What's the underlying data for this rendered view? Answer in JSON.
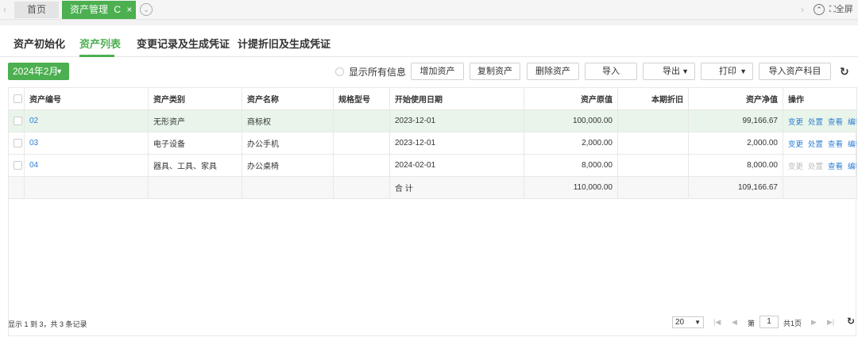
{
  "topbar": {
    "home_tab": "首页",
    "active_tab": "资产管理",
    "refresh_glyph": "C",
    "close_glyph": "×",
    "fullscreen_label": "全屏"
  },
  "subtabs": [
    "资产初始化",
    "资产列表",
    "变更记录及生成凭证",
    "计提折旧及生成凭证"
  ],
  "toolbar": {
    "period": "2024年2月",
    "show_all_label": "显示所有信息",
    "buttons": [
      "增加资产",
      "复制资产",
      "删除资产",
      "导入",
      "导出",
      "打印",
      "导入资产科目"
    ]
  },
  "table": {
    "headers": [
      "资产编号",
      "资产类别",
      "资产名称",
      "规格型号",
      "开始使用日期",
      "资产原值",
      "本期折旧",
      "资产净值",
      "操作"
    ],
    "rows": [
      {
        "code": "02",
        "category": "无形资产",
        "name": "商标权",
        "spec": "",
        "start_date": "2023-12-01",
        "original": "100,000.00",
        "depreciation": "",
        "net": "99,166.67",
        "actions": [
          "变更",
          "处置",
          "查看",
          "编辑"
        ]
      },
      {
        "code": "03",
        "category": "电子设备",
        "name": "办公手机",
        "spec": "",
        "start_date": "2023-12-01",
        "original": "2,000.00",
        "depreciation": "",
        "net": "2,000.00",
        "actions": [
          "变更",
          "处置",
          "查看",
          "编辑"
        ]
      },
      {
        "code": "04",
        "category": "器具、工具、家具",
        "name": "办公桌椅",
        "spec": "",
        "start_date": "2024-02-01",
        "original": "8,000.00",
        "depreciation": "",
        "net": "8,000.00",
        "actions": [
          "变更",
          "处置",
          "查看",
          "编辑"
        ]
      }
    ],
    "total_label": "合 计",
    "total_original": "110,000.00",
    "total_net": "109,166.67"
  },
  "footer": {
    "info": "显示 1 到 3，共 3 条记录",
    "page_size": "20",
    "page_prefix": "第",
    "page_value": "1",
    "page_total": "共1页"
  },
  "colors": {
    "accent": "#4caf50",
    "link": "#2d7fd3"
  }
}
